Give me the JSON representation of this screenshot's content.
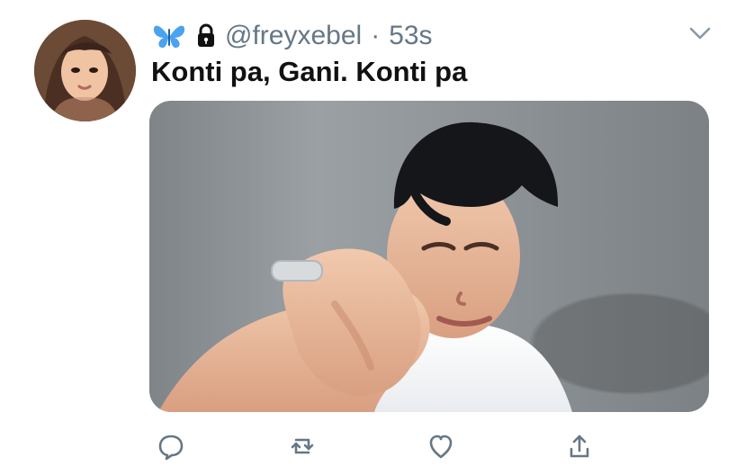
{
  "tweet": {
    "handle": "@freyxebel",
    "time_separator": "·",
    "timestamp": "53s",
    "text": "Konti pa, Gani. Konti pa"
  },
  "icons": {
    "butterfly": "butterfly-icon",
    "lock": "lock-icon",
    "caret": "chevron-down-icon",
    "reply": "reply-icon",
    "retweet": "retweet-icon",
    "like": "heart-icon",
    "share": "share-icon"
  },
  "colors": {
    "accent_text": "#657786",
    "text": "#111111",
    "icon": "#657786"
  }
}
